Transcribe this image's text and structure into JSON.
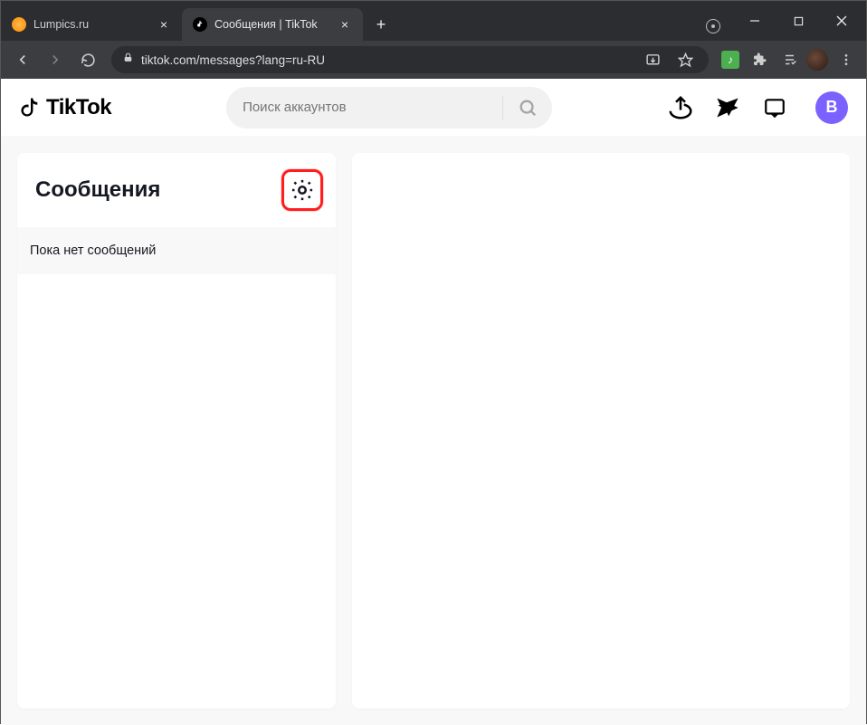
{
  "window": {
    "tabs": [
      {
        "title": "Lumpics.ru",
        "active": false
      },
      {
        "title": "Сообщения | TikTok",
        "active": true
      }
    ]
  },
  "browser": {
    "url": "tiktok.com/messages?lang=ru-RU"
  },
  "header": {
    "logo_text": "TikTok",
    "search_placeholder": "Поиск аккаунтов",
    "avatar_letter": "B"
  },
  "messages": {
    "title": "Сообщения",
    "empty_text": "Пока нет сообщений"
  },
  "colors": {
    "highlight": "#ff1d1d",
    "avatar_bg": "#7b61ff"
  }
}
